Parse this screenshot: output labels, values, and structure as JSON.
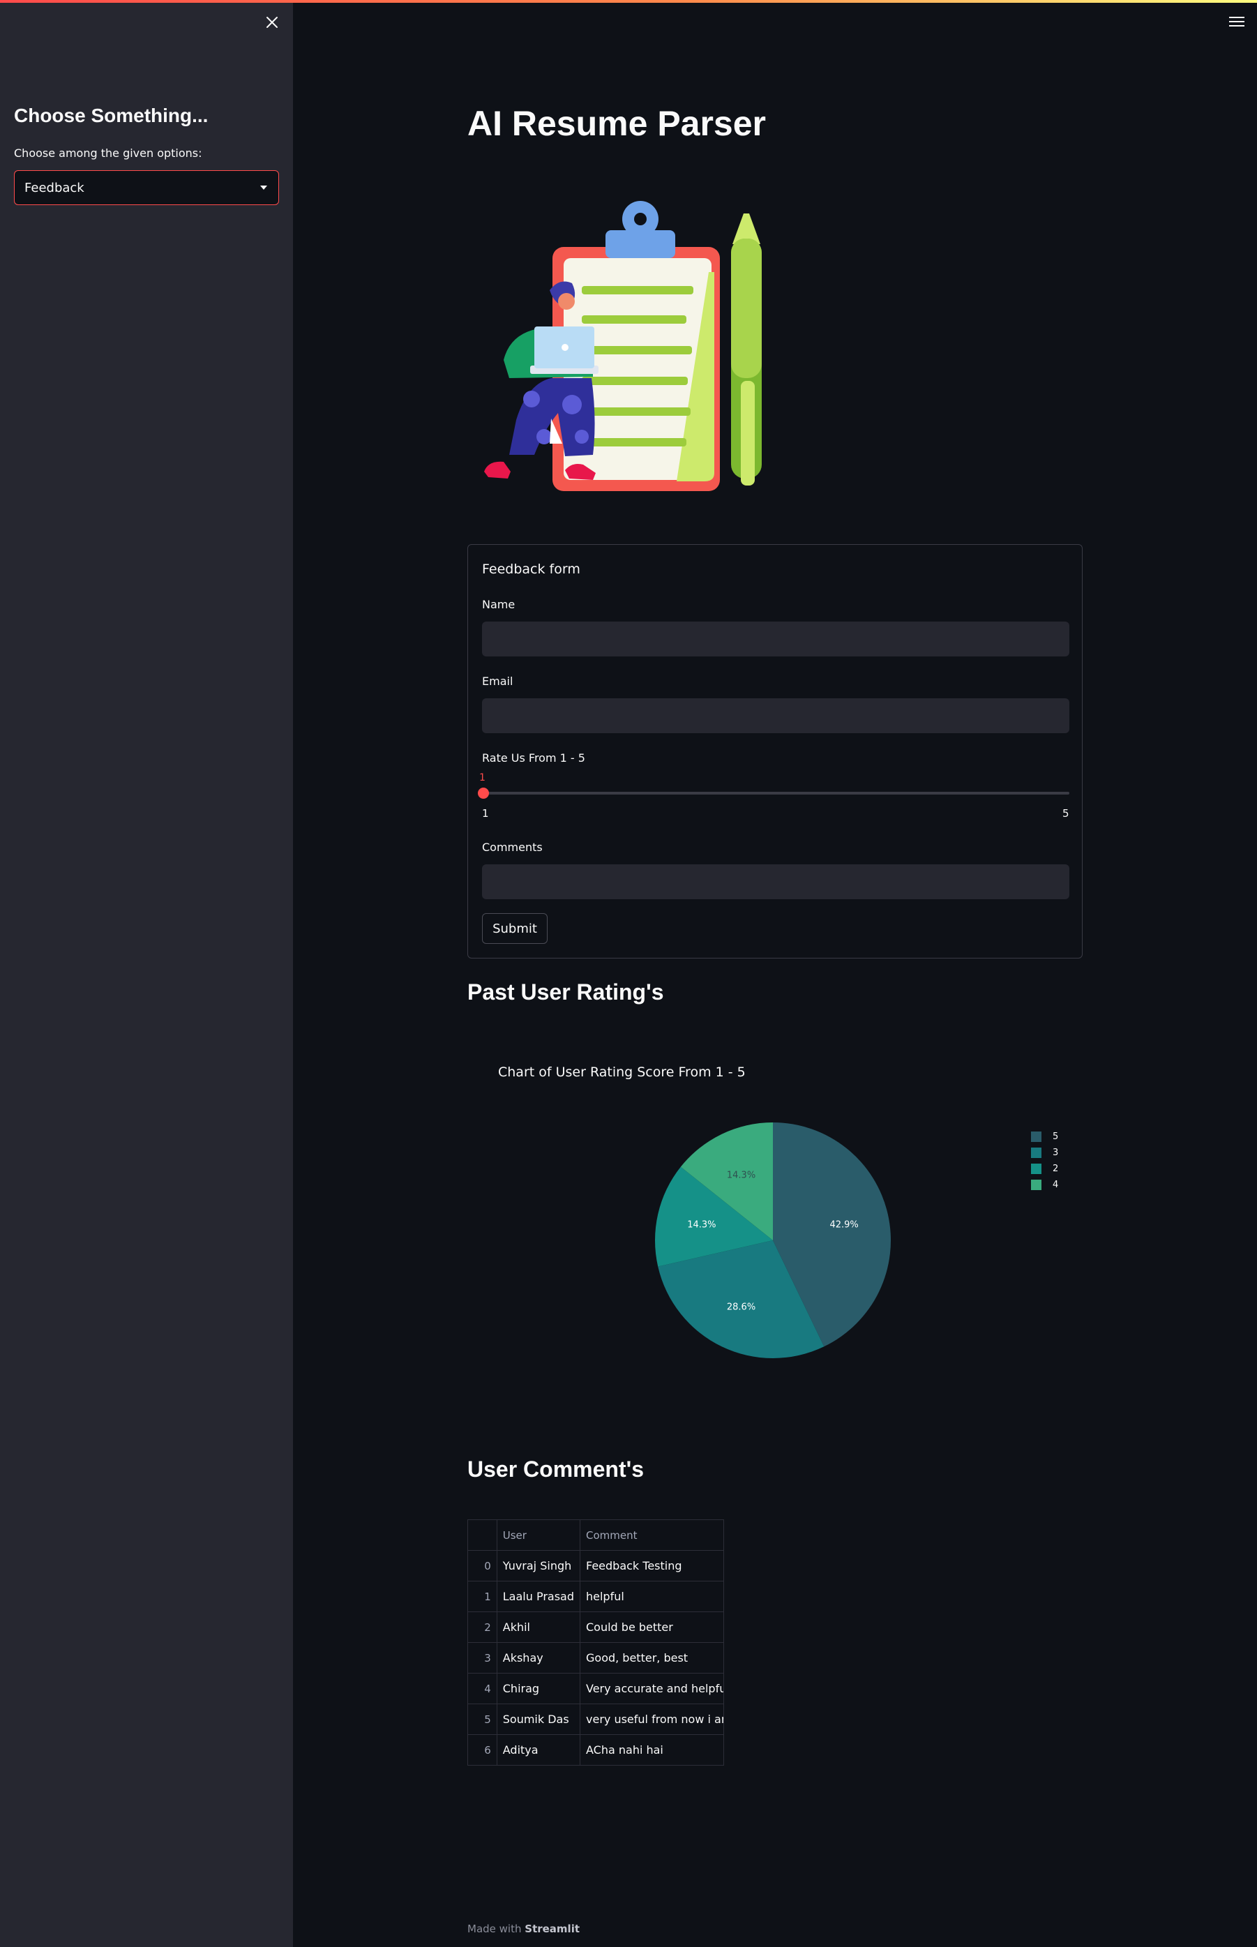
{
  "sidebar": {
    "heading": "Choose Something...",
    "select_label": "Choose among the given options:",
    "select_value": "Feedback",
    "close_icon": "close-icon"
  },
  "header": {
    "menu_icon": "hamburger-menu-icon"
  },
  "main": {
    "title": "AI Resume Parser",
    "hero_image": "resume-clipboard-illustration",
    "form": {
      "title": "Feedback form",
      "name_label": "Name",
      "name_value": "",
      "email_label": "Email",
      "email_value": "",
      "rating_label": "Rate Us From 1 - 5",
      "rating_value": "1",
      "rating_min": "1",
      "rating_max": "5",
      "comments_label": "Comments",
      "comments_value": "",
      "submit_label": "Submit"
    },
    "ratings_heading": "Past User Rating's",
    "comments_heading": "User Comment's"
  },
  "chart_data": {
    "type": "pie",
    "title": "Chart of User Rating Score From 1 - 5",
    "categories": [
      "5",
      "3",
      "2",
      "4"
    ],
    "values": [
      42.9,
      28.6,
      14.3,
      14.3
    ],
    "labels": [
      "42.9%",
      "28.6%",
      "14.3%",
      "14.3%"
    ],
    "colors": [
      "#2a5c6a",
      "#187a80",
      "#159188",
      "#3aab7e"
    ],
    "label_colors": [
      "#ffffff",
      "#ffffff",
      "#ffffff",
      "#2f5050"
    ],
    "legend_position": "top-right"
  },
  "comments_table": {
    "columns": [
      "",
      "User",
      "Comment"
    ],
    "rows": [
      {
        "index": "0",
        "user": "Yuvraj Singh",
        "comment": "Feedback Testing"
      },
      {
        "index": "1",
        "user": "Laalu Prasad",
        "comment": "helpful"
      },
      {
        "index": "2",
        "user": "Akhil",
        "comment": "Could be better"
      },
      {
        "index": "3",
        "user": "Akshay",
        "comment": "Good, better, best"
      },
      {
        "index": "4",
        "user": "Chirag",
        "comment": "Very accurate and helpful"
      },
      {
        "index": "5",
        "user": "Soumik Das",
        "comment": "very useful from now i am g"
      },
      {
        "index": "6",
        "user": "Aditya",
        "comment": "ACha nahi hai"
      }
    ]
  },
  "footer": {
    "prefix": "Made with",
    "brand": "Streamlit"
  }
}
